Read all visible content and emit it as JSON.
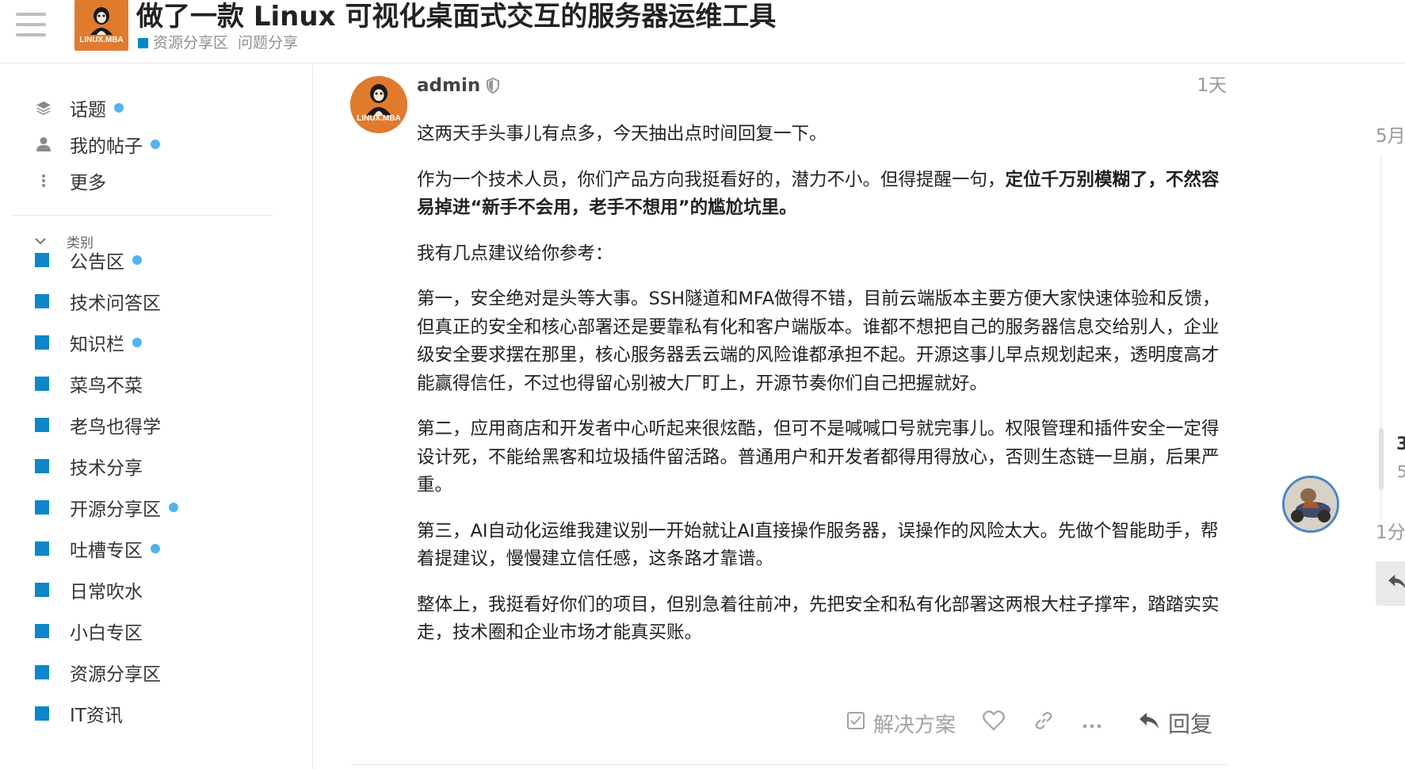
{
  "header": {
    "title": "做了一款 Linux 可视化桌面式交互的服务器运维工具",
    "category": "资源分享区",
    "tag": "问题分享",
    "logo_text": "LINUX.MBA"
  },
  "sidebar": {
    "nav": [
      {
        "label": "话题",
        "icon": "layers-icon",
        "unread": true
      },
      {
        "label": "我的帖子",
        "icon": "user-icon",
        "unread": true
      },
      {
        "label": "更多",
        "icon": "vertical-ellipsis-icon",
        "unread": false
      }
    ],
    "section_label": "类别",
    "categories": [
      {
        "label": "公告区",
        "unread": true
      },
      {
        "label": "技术问答区",
        "unread": false
      },
      {
        "label": "知识栏",
        "unread": true
      },
      {
        "label": "菜鸟不菜",
        "unread": false
      },
      {
        "label": "老鸟也得学",
        "unread": false
      },
      {
        "label": "技术分享",
        "unread": false
      },
      {
        "label": "开源分享区",
        "unread": true
      },
      {
        "label": "吐槽专区",
        "unread": true
      },
      {
        "label": "日常吹水",
        "unread": false
      },
      {
        "label": "小白专区",
        "unread": false
      },
      {
        "label": "资源分享区",
        "unread": false
      },
      {
        "label": "IT资讯",
        "unread": false
      }
    ],
    "category_color": "#0e86ca",
    "unread_dot_color": "#50b5ef"
  },
  "post": {
    "author": "admin",
    "date": "1天",
    "avatar_text": "LINUX.MBA",
    "p1": "这两天手头事儿有点多，今天抽出点时间回复一下。",
    "p2_normal": "作为一个技术人员，你们产品方向我挺看好的，潜力不小。但得提醒一句，",
    "p2_bold": "定位千万别模糊了，不然容易掉进“新手不会用，老手不想用”的尴尬坑里。",
    "p3": "我有几点建议给你参考：",
    "p4": "第一，安全绝对是头等大事。SSH隧道和MFA做得不错，目前云端版本主要方便大家快速体验和反馈，但真正的安全和核心部署还是要靠私有化和客户端版本。谁都不想把自己的服务器信息交给别人，企业级安全要求摆在那里，核心服务器丢云端的风险谁都承担不起。开源这事儿早点规划起来，透明度高才能赢得信任，不过也得留心别被大厂盯上，开源节奏你们自己把握就好。",
    "p5": "第二，应用商店和开发者中心听起来很炫酷，但可不是喊喊口号就完事儿。权限管理和插件安全一定得设计死，不能给黑客和垃圾插件留活路。普通用户和开发者都得用得放心，否则生态链一旦崩，后果严重。",
    "p6": "第三，AI自动化运维我建议别一开始就让AI直接操作服务器，误操作的风险太大。先做个智能助手，帮着提建议，慢慢建立信任感，这条路才靠谱。",
    "p7": "整体上，我挺看好你们的项目，但别急着往前冲，先把安全和私有化部署这两根大柱子撑牢，踏踏实实走，技术圈和企业市场才能真买账。"
  },
  "actions": {
    "solution_label": "解决方案",
    "reply_label": "回复",
    "icons": [
      "checkbox-icon",
      "heart-icon",
      "link-icon",
      "more-icon",
      "reply-icon"
    ]
  },
  "timeline": {
    "start_label": "5月",
    "current_label": "3",
    "current_sub": "5",
    "end_label": "1分"
  },
  "colors": {
    "accent": "#0088cc",
    "brand_orange": "#e07b2e",
    "muted_text": "#999999"
  }
}
